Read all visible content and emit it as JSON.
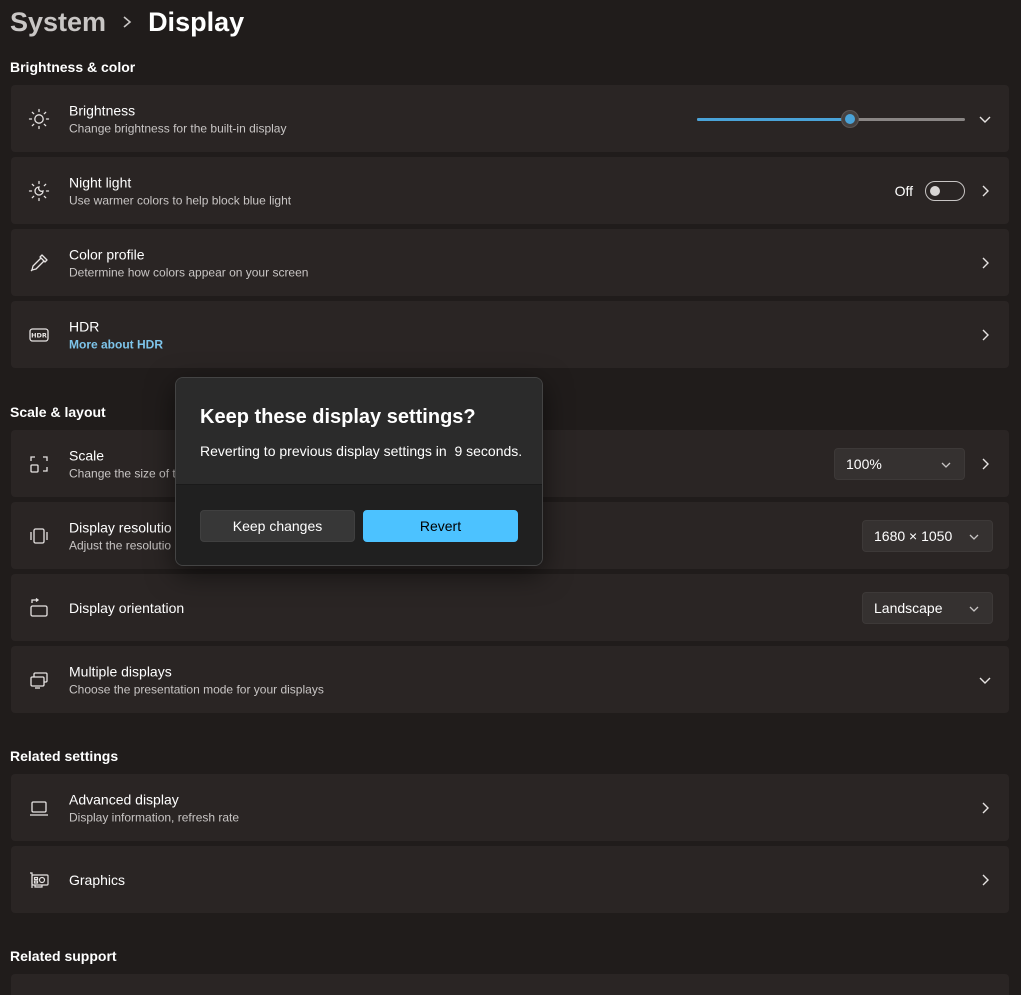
{
  "breadcrumb": {
    "parent": "System",
    "current": "Display"
  },
  "sections": {
    "brightness_color": "Brightness & color",
    "scale_layout": "Scale & layout",
    "related_settings": "Related settings",
    "related_support": "Related support"
  },
  "brightness": {
    "title": "Brightness",
    "sub": "Change brightness for the built-in display",
    "level_percent": 57
  },
  "night_light": {
    "title": "Night light",
    "sub": "Use warmer colors to help block blue light",
    "state": "Off"
  },
  "color_profile": {
    "title": "Color profile",
    "sub": "Determine how colors appear on your screen"
  },
  "hdr": {
    "title": "HDR",
    "link": "More about HDR"
  },
  "scale": {
    "title": "Scale",
    "sub": "Change the size of t",
    "value": "100%"
  },
  "resolution": {
    "title": "Display resolutio",
    "sub": "Adjust the resolutio",
    "value": "1680 × 1050"
  },
  "orientation": {
    "title": "Display orientation",
    "value": "Landscape"
  },
  "multiple_displays": {
    "title": "Multiple displays",
    "sub": "Choose the presentation mode for your displays"
  },
  "advanced_display": {
    "title": "Advanced display",
    "sub": "Display information, refresh rate"
  },
  "graphics": {
    "title": "Graphics"
  },
  "dialog": {
    "title": "Keep these display settings?",
    "message": "Reverting to previous display settings in  9 seconds.",
    "keep_label": "Keep changes",
    "revert_label": "Revert"
  },
  "colors": {
    "accent": "#4cc2ff",
    "link": "#7ec5eb",
    "background": "#201c1b",
    "card": "#2a2524"
  }
}
